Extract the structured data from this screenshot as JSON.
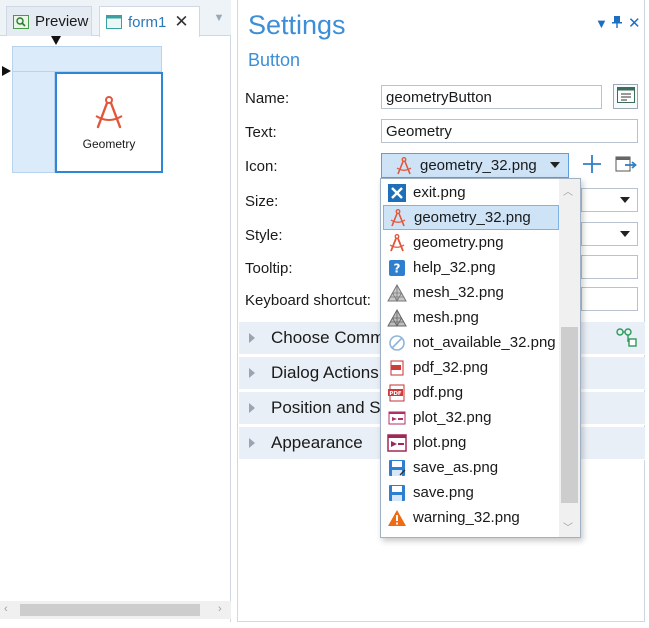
{
  "tabs": [
    {
      "label": "Preview",
      "icon": "search-icon"
    },
    {
      "label": "form1",
      "icon": "form-icon"
    }
  ],
  "canvas": {
    "cell_label": "Geometry"
  },
  "settings": {
    "title": "Settings",
    "subtitle": "Button",
    "fields": {
      "name_label": "Name:",
      "name_value": "geometryButton",
      "text_label": "Text:",
      "text_value": "Geometry",
      "icon_label": "Icon:",
      "icon_value": "geometry_32.png",
      "size_label": "Size:",
      "style_label": "Style:",
      "tooltip_label": "Tooltip:",
      "shortcut_label": "Keyboard shortcut:"
    },
    "sections": [
      {
        "label": "Choose Comm"
      },
      {
        "label": "Dialog Actions"
      },
      {
        "label": "Position and Si"
      },
      {
        "label": "Appearance"
      }
    ]
  },
  "icon_dropdown": {
    "items": [
      {
        "label": "exit.png",
        "icon": "exit-icon"
      },
      {
        "label": "geometry_32.png",
        "icon": "geometry-icon",
        "selected": true
      },
      {
        "label": "geometry.png",
        "icon": "geometry-icon"
      },
      {
        "label": "help_32.png",
        "icon": "help-icon"
      },
      {
        "label": "mesh_32.png",
        "icon": "mesh-icon"
      },
      {
        "label": "mesh.png",
        "icon": "mesh-icon"
      },
      {
        "label": "not_available_32.png",
        "icon": "not-available-icon"
      },
      {
        "label": "pdf_32.png",
        "icon": "pdf-icon"
      },
      {
        "label": "pdf.png",
        "icon": "pdf-icon"
      },
      {
        "label": "plot_32.png",
        "icon": "plot-icon"
      },
      {
        "label": "plot.png",
        "icon": "plot-icon"
      },
      {
        "label": "save_as.png",
        "icon": "save-as-icon"
      },
      {
        "label": "save.png",
        "icon": "save-icon"
      },
      {
        "label": "warning_32.png",
        "icon": "warning-icon"
      }
    ]
  },
  "colors": {
    "accent": "#3c8fd6",
    "selection": "#cfe3f7",
    "section_bg": "#e9eff6",
    "geometry_icon": "#e2573b"
  }
}
